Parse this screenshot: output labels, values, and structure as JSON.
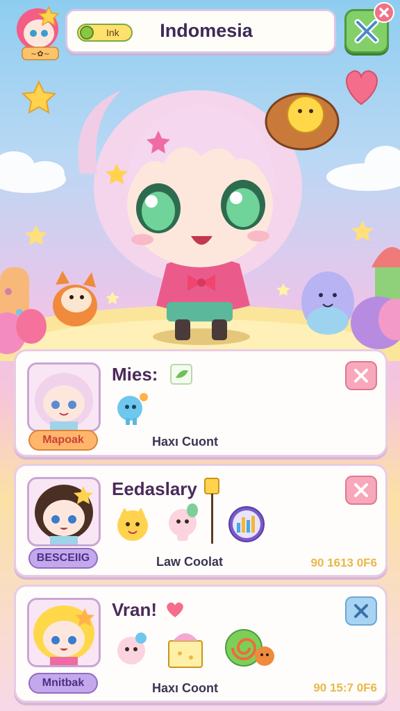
{
  "hud": {
    "currency_label": "Ink",
    "country_title": "Indomesia",
    "avatar_tag": "~✿~"
  },
  "panels": [
    {
      "name": "Mies:",
      "badge": "Mapoak",
      "stat": "Haxı Cuont",
      "number": "",
      "button": "close-pink"
    },
    {
      "name": "Eedaslary",
      "badge": "BESCEIIG",
      "stat": "Law Coolat",
      "number": "90 1613 0F6",
      "button": "close-pink"
    },
    {
      "name": "Vran!",
      "badge": "Mnitbak",
      "stat": "Haxı Coont",
      "number": "90 15:7 0F6",
      "button": "close-blue"
    }
  ],
  "colors": {
    "accent_pink": "#f8a8bb",
    "accent_green": "#83d06a",
    "accent_blue": "#a7d4f3",
    "title_text": "#3b2a58"
  }
}
